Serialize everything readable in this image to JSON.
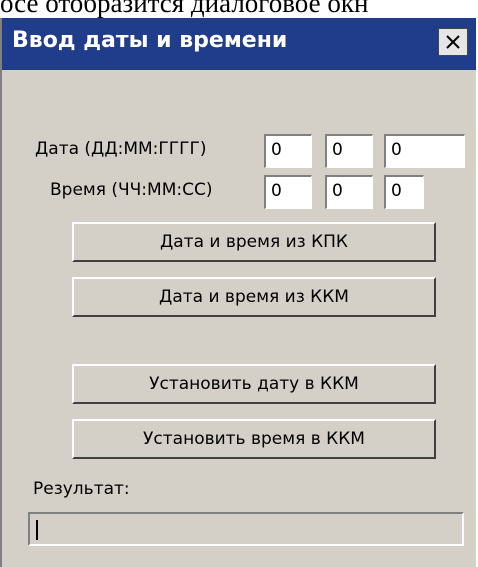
{
  "document": {
    "visible_text": "осе отобразится диалоговое окн"
  },
  "dialog": {
    "title": "Ввод даты и времени",
    "close_icon": "close-icon",
    "colors": {
      "titlebar": "#1f3d8a",
      "face": "#d4d0c8"
    }
  },
  "date": {
    "label": "Дата (ДД:ММ:ГГГГ)",
    "day": "0",
    "month": "0",
    "year": "0"
  },
  "time": {
    "label": "Время (ЧЧ:ММ:СС)",
    "hours": "0",
    "minutes": "0",
    "seconds": "0"
  },
  "buttons": {
    "from_pda": "Дата и время из КПК",
    "from_kkm": "Дата и время из ККМ",
    "set_date": "Установить дату в ККМ",
    "set_time": "Установить время в ККМ"
  },
  "result": {
    "label": "Результат:",
    "value": ""
  }
}
